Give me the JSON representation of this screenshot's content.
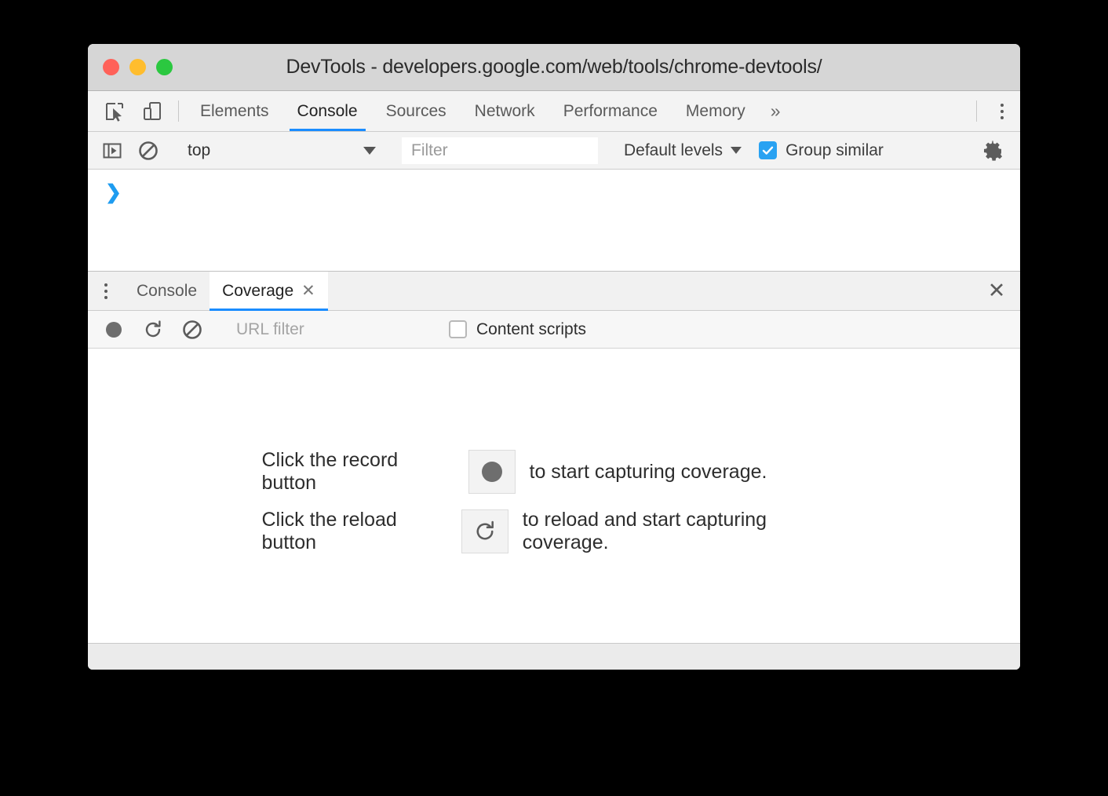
{
  "window": {
    "title": "DevTools - developers.google.com/web/tools/chrome-devtools/",
    "traffic_lights": [
      {
        "name": "close",
        "color": "#ff6159"
      },
      {
        "name": "minimize",
        "color": "#ffbd2e"
      },
      {
        "name": "maximize",
        "color": "#2bc840"
      }
    ]
  },
  "toolbar": {
    "inspect_icon": "inspect-element-icon",
    "device_icon": "device-toolbar-icon",
    "more_tabs_label": "»",
    "main_menu_icon": "kebab-menu-icon",
    "tabs": [
      {
        "label": "Elements",
        "active": false
      },
      {
        "label": "Console",
        "active": true
      },
      {
        "label": "Sources",
        "active": false
      },
      {
        "label": "Network",
        "active": false
      },
      {
        "label": "Performance",
        "active": false
      },
      {
        "label": "Memory",
        "active": false
      }
    ]
  },
  "console_toolbar": {
    "sidebar_toggle_icon": "console-sidebar-toggle-icon",
    "clear_icon": "clear-console-icon",
    "context_value": "top",
    "filter_placeholder": "Filter",
    "levels_value": "Default levels",
    "group_similar_label": "Group similar",
    "group_similar_checked": true,
    "settings_icon": "gear-icon"
  },
  "console_output": {
    "prompt": "❯"
  },
  "drawer": {
    "menu_icon": "drawer-kebab-icon",
    "close_label": "✕",
    "tabs": [
      {
        "label": "Console",
        "active": false,
        "closable": false,
        "close_label": ""
      },
      {
        "label": "Coverage",
        "active": true,
        "closable": true,
        "close_label": "✕"
      }
    ]
  },
  "coverage_toolbar": {
    "record_icon": "record-icon",
    "reload_icon": "reload-icon",
    "clear_icon": "clear-coverage-icon",
    "url_filter_placeholder": "URL filter",
    "content_scripts_label": "Content scripts",
    "content_scripts_checked": false
  },
  "coverage_content": {
    "rows": [
      {
        "lead": "Click the record button",
        "icon": "record-icon",
        "trail": "to start capturing coverage."
      },
      {
        "lead": "Click the reload button",
        "icon": "reload-icon",
        "trail": "to reload and start capturing coverage."
      }
    ]
  },
  "colors": {
    "accent_blue": "#1a8cff",
    "checkbox_blue": "#29a2f2",
    "prompt_blue": "#1e9cf0",
    "record_gray": "#6e6e6e",
    "titlebar_gray": "#d6d6d6",
    "toolbar_gray": "#f3f3f3"
  }
}
